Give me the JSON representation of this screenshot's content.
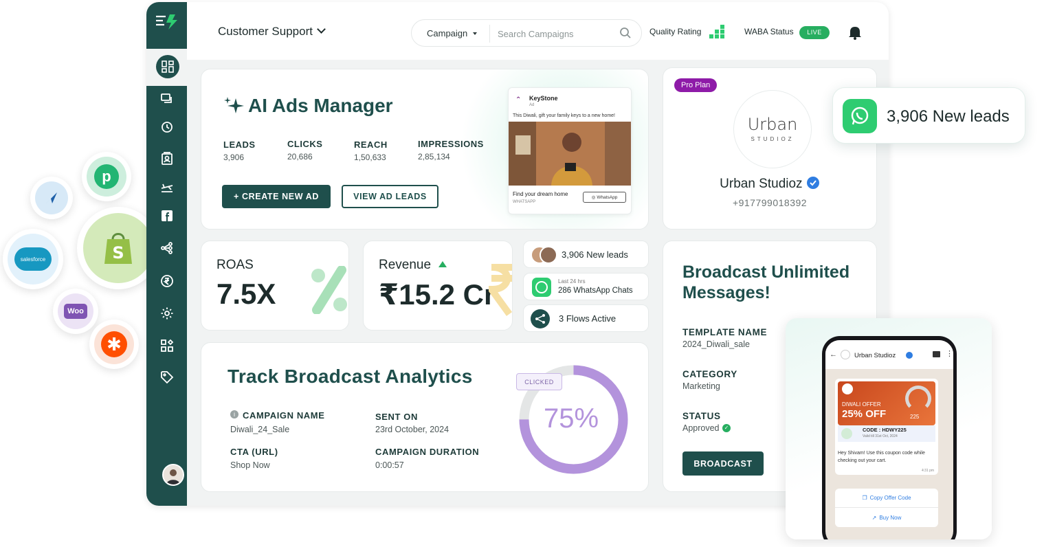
{
  "header": {
    "workspace": "Customer Support",
    "search_scope": "Campaign",
    "search_placeholder": "Search Campaigns",
    "quality_label": "Quality Rating",
    "waba_label": "WABA Status",
    "waba_status": "LIVE"
  },
  "ads": {
    "title": "AI Ads Manager",
    "metrics": [
      {
        "label": "LEADS",
        "value": "3,906"
      },
      {
        "label": "CLICKS",
        "value": "20,686"
      },
      {
        "label": "REACH",
        "value": "1,50,633"
      },
      {
        "label": "IMPRESSIONS",
        "value": "2,85,134"
      }
    ],
    "create_button": "+ CREATE NEW AD",
    "view_button": "VIEW AD LEADS",
    "preview": {
      "brand": "KeyStone",
      "brand_sub": "Ad",
      "caption": "This Diwali, gift your family keys to a new home!",
      "cta_text": "Find your dream home",
      "cta_sub": "WHATSAPP",
      "cta_button": "WhatsApp"
    }
  },
  "profile": {
    "plan_badge": "Pro Plan",
    "logo_main": "Urban",
    "logo_sub": "STUDIOZ",
    "name": "Urban Studioz",
    "phone": "+917799018392"
  },
  "lead_badge": "3,906 New leads",
  "roas": {
    "label": "ROAS",
    "value": "7.5X"
  },
  "revenue": {
    "label": "Revenue",
    "value": "₹15.2 Cr"
  },
  "mini_stats": [
    {
      "text": "3,906 New leads"
    },
    {
      "sub": "Last 24 hrs",
      "text": "286 WhatsApp Chats"
    },
    {
      "text": "3 Flows Active"
    }
  ],
  "analytics": {
    "title": "Track Broadcast Analytics",
    "fields": [
      {
        "label": "CAMPAIGN NAME",
        "value": "Diwali_24_Sale"
      },
      {
        "label": "SENT ON",
        "value": "23rd October, 2024"
      },
      {
        "label": "CTA (URL)",
        "value": "Shop Now"
      },
      {
        "label": "CAMPAIGN DURATION",
        "value": "0:00:57"
      }
    ],
    "clicked_label": "CLICKED",
    "clicked_percent": "75%",
    "clicked_fraction": 0.75,
    "ring_color": "#b393dc"
  },
  "broadcast": {
    "title": "Broadcast Unlimited Messages!",
    "fields": [
      {
        "label": "TEMPLATE NAME",
        "value": "2024_Diwali_sale"
      },
      {
        "label": "CATEGORY",
        "value": "Marketing"
      },
      {
        "label": "STATUS",
        "value": "Approved"
      }
    ],
    "button": "BROADCAST"
  },
  "phone": {
    "contact": "Urban Studioz",
    "offer_title": "DIWALI OFFER",
    "offer_value": "25% OFF",
    "offer_badge": "225",
    "code": "CODE : HDWY225",
    "valid": "Valid till 31st Oct, 2024",
    "message": "Hey Shivam! Use this coupon code while checking out your cart.",
    "time": "4:31 pm",
    "link1": "Copy Offer Code",
    "link2": "Buy Now"
  },
  "integrations": [
    "pabbly-icon",
    "sendinblue-icon",
    "salesforce-icon",
    "shopify-icon",
    "woocommerce-icon",
    "zapier-icon"
  ],
  "colors": {
    "brand": "#1f4f4c",
    "live": "#27ae60",
    "pro": "#8e1ba8",
    "whatsapp": "#2ecc71"
  }
}
